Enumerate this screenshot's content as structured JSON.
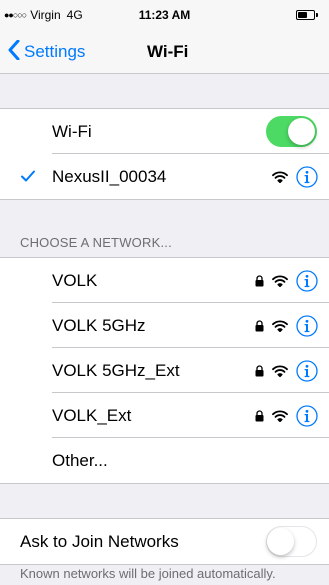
{
  "status_bar": {
    "signal": "●●○○○",
    "carrier": "Virgin",
    "network": "4G",
    "time": "11:23 AM"
  },
  "nav": {
    "back_label": "Settings",
    "title": "Wi-Fi"
  },
  "wifi": {
    "label": "Wi-Fi",
    "enabled": true,
    "connected_network": "NexusII_00034"
  },
  "choose_header": "CHOOSE A NETWORK...",
  "networks": [
    {
      "name": "VOLK",
      "locked": true
    },
    {
      "name": "VOLK 5GHz",
      "locked": true
    },
    {
      "name": "VOLK 5GHz_Ext",
      "locked": true
    },
    {
      "name": "VOLK_Ext",
      "locked": true
    }
  ],
  "other_label": "Other...",
  "ask_to_join": {
    "label": "Ask to Join Networks",
    "enabled": false
  },
  "footer": "Known networks will be joined automatically.",
  "colors": {
    "accent": "#007aff",
    "toggle_on": "#4cd964",
    "background": "#efeff4"
  },
  "icons": [
    "checkmark-icon",
    "lock-icon",
    "wifi-icon",
    "info-icon",
    "chevron-left-icon",
    "battery-icon"
  ]
}
